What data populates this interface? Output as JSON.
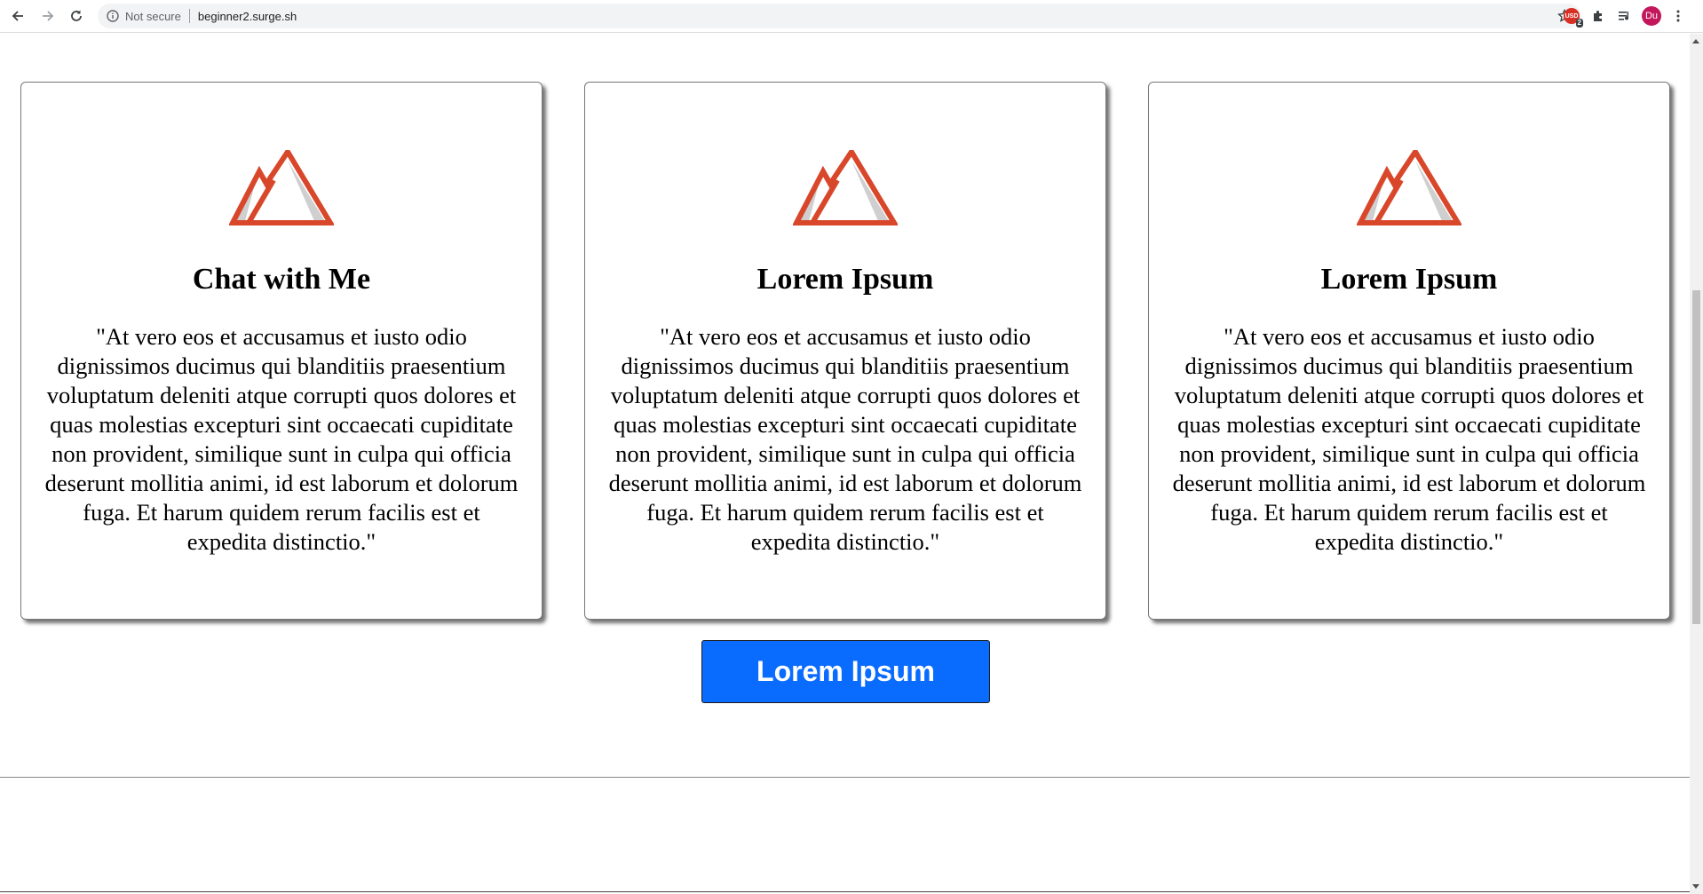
{
  "browser": {
    "security_text": "Not secure",
    "url": "beginner2.surge.sh",
    "extension_badge": "USD",
    "extension_badge_count": "2",
    "profile_initials": "Du"
  },
  "cards": [
    {
      "title": "Chat with Me",
      "text": "\"At vero eos et accusamus et iusto odio dignissimos ducimus qui blanditiis praesentium voluptatum deleniti atque corrupti quos dolores et quas molestias excepturi sint occaecati cupiditate non provident, similique sunt in culpa qui officia deserunt mollitia animi, id est laborum et dolorum fuga. Et harum quidem rerum facilis est et expedita distinctio.\""
    },
    {
      "title": "Lorem Ipsum",
      "text": "\"At vero eos et accusamus et iusto odio dignissimos ducimus qui blanditiis praesentium voluptatum deleniti atque corrupti quos dolores et quas molestias excepturi sint occaecati cupiditate non provident, similique sunt in culpa qui officia deserunt mollitia animi, id est laborum et dolorum fuga. Et harum quidem rerum facilis est et expedita distinctio.\""
    },
    {
      "title": "Lorem Ipsum",
      "text": "\"At vero eos et accusamus et iusto odio dignissimos ducimus qui blanditiis praesentium voluptatum deleniti atque corrupti quos dolores et quas molestias excepturi sint occaecati cupiditate non provident, similique sunt in culpa qui officia deserunt mollitia animi, id est laborum et dolorum fuga. Et harum quidem rerum facilis est et expedita distinctio.\""
    }
  ],
  "cta_label": "Lorem Ipsum",
  "icons": {
    "card_logo": "mountain-logo-icon"
  },
  "colors": {
    "logo_orange": "#d9472b",
    "logo_gray": "#cfcfcf",
    "button_blue": "#0a6cff"
  }
}
